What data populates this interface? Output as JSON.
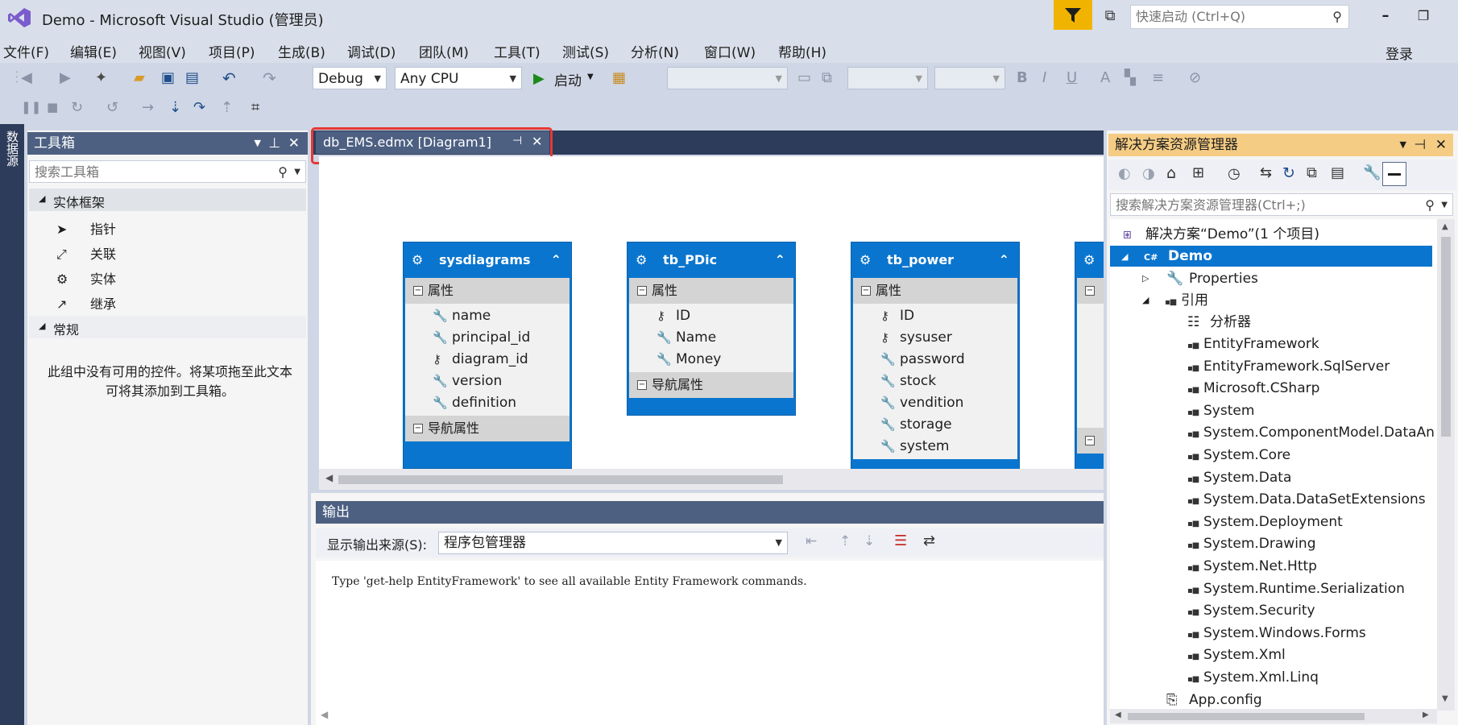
{
  "window": {
    "title": "Demo - Microsoft Visual Studio (管理员)",
    "quick_launch_placeholder": "快速启动 (Ctrl+Q)",
    "login": "登录"
  },
  "menu": [
    "文件(F)",
    "编辑(E)",
    "视图(V)",
    "项目(P)",
    "生成(B)",
    "调试(D)",
    "团队(M)",
    "工具(T)",
    "测试(S)",
    "分析(N)",
    "窗口(W)",
    "帮助(H)"
  ],
  "toolbar": {
    "config": "Debug",
    "platform": "Any CPU",
    "start_label": "启动"
  },
  "left_strip_label": "数据源",
  "toolbox": {
    "title": "工具箱",
    "search_placeholder": "搜索工具箱",
    "group1": "实体框架",
    "items": [
      "指针",
      "关联",
      "实体",
      "继承"
    ],
    "group2": "常规",
    "empty_message": "此组中没有可用的控件。将某项拖至此文本可将其添加到工具箱。"
  },
  "document": {
    "tab_label": "db_EMS.edmx [Diagram1]",
    "entities": [
      {
        "name": "sysdiagrams",
        "section": "属性",
        "props": [
          "name",
          "principal_id",
          "diagram_id",
          "version",
          "definition"
        ],
        "nav": "导航属性"
      },
      {
        "name": "tb_PDic",
        "section": "属性",
        "props": [
          "ID",
          "Name",
          "Money"
        ],
        "nav": "导航属性"
      },
      {
        "name": "tb_power",
        "section": "属性",
        "props": [
          "ID",
          "sysuser",
          "password",
          "stock",
          "vendition",
          "storage",
          "system"
        ]
      }
    ]
  },
  "output": {
    "title": "输出",
    "source_label": "显示输出来源(S):",
    "source_value": "程序包管理器",
    "text": "Type 'get-help EntityFramework' to see all available Entity Framework commands."
  },
  "solution_explorer": {
    "title": "解决方案资源管理器",
    "search_placeholder": "搜索解决方案资源管理器(Ctrl+;)",
    "solution": "解决方案“Demo”(1 个项目)",
    "project": "Demo",
    "properties": "Properties",
    "references": "引用",
    "analyzer": "分析器",
    "refs": [
      "EntityFramework",
      "EntityFramework.SqlServer",
      "Microsoft.CSharp",
      "System",
      "System.ComponentModel.DataAn",
      "System.Core",
      "System.Data",
      "System.Data.DataSetExtensions",
      "System.Deployment",
      "System.Drawing",
      "System.Net.Http",
      "System.Runtime.Serialization",
      "System.Security",
      "System.Windows.Forms",
      "System.Xml",
      "System.Xml.Linq"
    ],
    "app_config": "App.config"
  },
  "colors": {
    "accent": "#0a75ce",
    "highlight": "#f5cc84",
    "filter": "#f0b400",
    "tab_outline": "#e53935"
  }
}
